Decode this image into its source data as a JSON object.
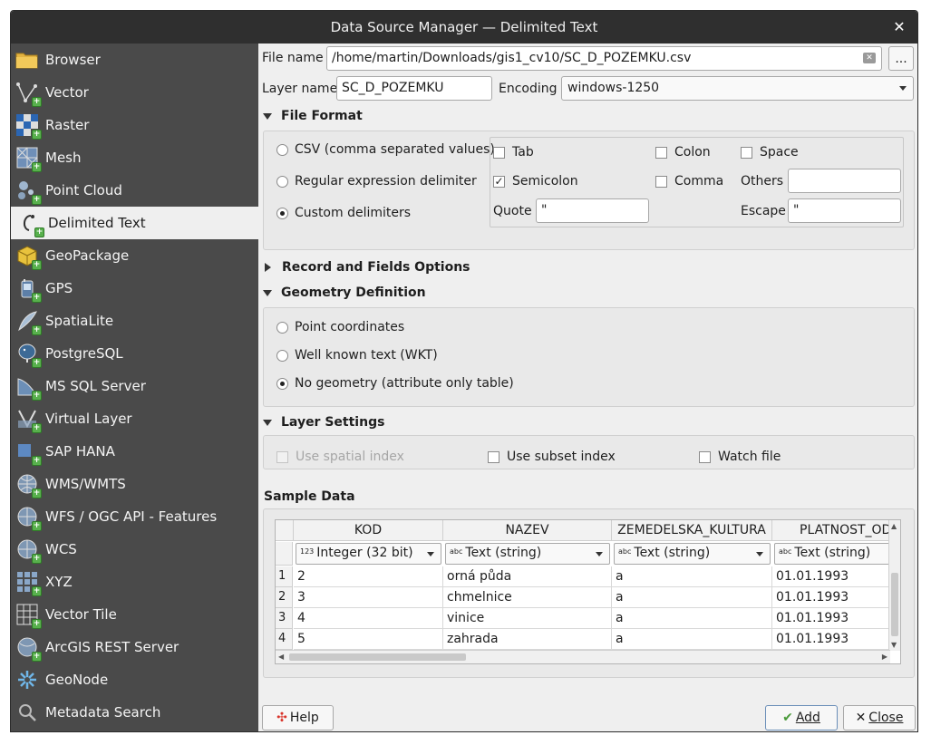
{
  "window": {
    "title": "Data Source Manager — Delimited Text"
  },
  "sidebar": {
    "items": [
      {
        "label": "Browser",
        "icon": "folder-icon"
      },
      {
        "label": "Vector",
        "icon": "vector-icon"
      },
      {
        "label": "Raster",
        "icon": "raster-icon"
      },
      {
        "label": "Mesh",
        "icon": "mesh-icon"
      },
      {
        "label": "Point Cloud",
        "icon": "point-cloud-icon"
      },
      {
        "label": "Delimited Text",
        "icon": "delimited-text-icon",
        "selected": true
      },
      {
        "label": "GeoPackage",
        "icon": "geopackage-icon"
      },
      {
        "label": "GPS",
        "icon": "gps-icon"
      },
      {
        "label": "SpatiaLite",
        "icon": "spatialite-icon"
      },
      {
        "label": "PostgreSQL",
        "icon": "postgresql-icon"
      },
      {
        "label": "MS SQL Server",
        "icon": "mssql-icon"
      },
      {
        "label": "Virtual Layer",
        "icon": "virtual-layer-icon"
      },
      {
        "label": "SAP HANA",
        "icon": "sap-hana-icon"
      },
      {
        "label": "WMS/WMTS",
        "icon": "wms-icon"
      },
      {
        "label": "WFS / OGC API - Features",
        "icon": "wfs-icon"
      },
      {
        "label": "WCS",
        "icon": "wcs-icon"
      },
      {
        "label": "XYZ",
        "icon": "xyz-icon"
      },
      {
        "label": "Vector Tile",
        "icon": "vector-tile-icon"
      },
      {
        "label": "ArcGIS REST Server",
        "icon": "arcgis-icon"
      },
      {
        "label": "GeoNode",
        "icon": "geonode-icon"
      },
      {
        "label": "Metadata Search",
        "icon": "search-icon"
      }
    ]
  },
  "file": {
    "label": "File name",
    "value": "/home/martin/Downloads/gis1_cv10/SC_D_POZEMKU.csv",
    "browse_label": "..."
  },
  "layer": {
    "label": "Layer name",
    "value": "SC_D_POZEMKU",
    "encoding_label": "Encoding",
    "encoding_value": "windows-1250"
  },
  "file_format": {
    "title": "File Format",
    "radios": [
      "CSV (comma separated values)",
      "Regular expression delimiter",
      "Custom delimiters"
    ],
    "selected_radio": 2,
    "checks": {
      "tab": {
        "label": "Tab",
        "checked": false
      },
      "colon": {
        "label": "Colon",
        "checked": false
      },
      "space": {
        "label": "Space",
        "checked": false
      },
      "semicolon": {
        "label": "Semicolon",
        "checked": true
      },
      "comma": {
        "label": "Comma",
        "checked": false
      }
    },
    "others_label": "Others",
    "others_value": "",
    "quote_label": "Quote",
    "quote_value": "\"",
    "escape_label": "Escape",
    "escape_value": "\""
  },
  "record_fields": {
    "title": "Record and Fields Options"
  },
  "geometry": {
    "title": "Geometry Definition",
    "radios": [
      "Point coordinates",
      "Well known text (WKT)",
      "No geometry (attribute only table)"
    ],
    "selected_radio": 2
  },
  "layer_settings": {
    "title": "Layer Settings",
    "spatial_index": "Use spatial index",
    "subset_index": "Use subset index",
    "watch_file": "Watch file"
  },
  "sample": {
    "title": "Sample Data",
    "columns": [
      "KOD",
      "NAZEV",
      "ZEMEDELSKA_KULTURA",
      "PLATNOST_OD"
    ],
    "types": [
      {
        "prefix": "123",
        "label": "Integer (32 bit)"
      },
      {
        "prefix": "abc",
        "label": "Text (string)"
      },
      {
        "prefix": "abc",
        "label": "Text (string)"
      },
      {
        "prefix": "abc",
        "label": "Text (string)"
      }
    ],
    "rows": [
      {
        "n": "1",
        "cells": [
          "2",
          "orná půda",
          "a",
          "01.01.1993"
        ]
      },
      {
        "n": "2",
        "cells": [
          "3",
          "chmelnice",
          "a",
          "01.01.1993"
        ]
      },
      {
        "n": "3",
        "cells": [
          "4",
          "vinice",
          "a",
          "01.01.1993"
        ]
      },
      {
        "n": "4",
        "cells": [
          "5",
          "zahrada",
          "a",
          "01.01.1993"
        ]
      }
    ]
  },
  "buttons": {
    "help": "Help",
    "add": "Add",
    "close": "Close"
  },
  "colors": {
    "sidebar_bg": "#4a4a4a",
    "titlebar_bg": "#2f2f2f",
    "plus_green": "#58b04d"
  }
}
